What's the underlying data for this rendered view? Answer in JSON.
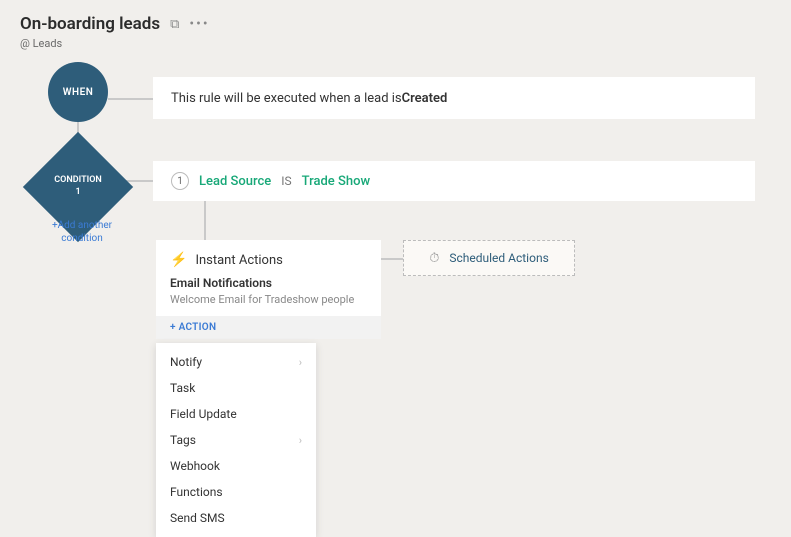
{
  "header": {
    "title": "On-boarding leads",
    "module": "@ Leads"
  },
  "when": {
    "node_label": "WHEN",
    "text_before": "This rule will be executed when a lead is ",
    "text_bold": "Created"
  },
  "condition": {
    "node_label_line1": "CONDITION",
    "node_label_line2": "1",
    "number": "1",
    "field": "Lead Source",
    "operator": "IS",
    "value": "Trade Show",
    "add_link": "+Add another condition"
  },
  "instant_actions": {
    "title": "Instant Actions",
    "group": "Email Notifications",
    "item": "Welcome Email for Tradeshow people",
    "add_label": "+ ACTION"
  },
  "scheduled_actions": {
    "title": "Scheduled Actions"
  },
  "action_menu": {
    "items": [
      {
        "label": "Notify",
        "submenu": true
      },
      {
        "label": "Task",
        "submenu": false
      },
      {
        "label": "Field Update",
        "submenu": false
      },
      {
        "label": "Tags",
        "submenu": true
      },
      {
        "label": "Webhook",
        "submenu": false
      },
      {
        "label": "Functions",
        "submenu": false
      },
      {
        "label": "Send SMS",
        "submenu": false
      }
    ]
  }
}
